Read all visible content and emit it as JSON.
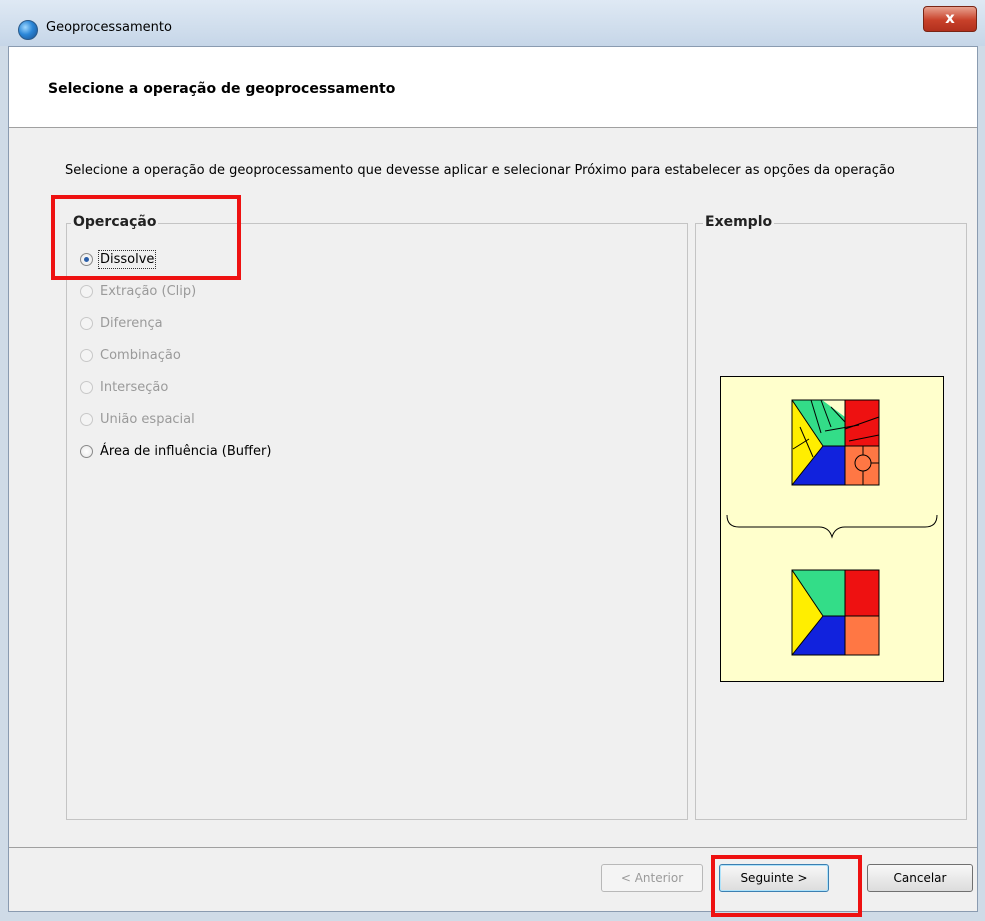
{
  "window": {
    "title": "Geoprocessamento",
    "close_label": "x"
  },
  "header": {
    "title": "Selecione a operação de geoprocessamento"
  },
  "instruction": "Selecione a operação de geoprocessamento que devesse aplicar e selecionar Próximo para estabelecer as opções da operação",
  "operation_group": {
    "legend": "Opercação",
    "options": [
      {
        "label": "Dissolve",
        "checked": true,
        "enabled": true
      },
      {
        "label": "Extração (Clip)",
        "checked": false,
        "enabled": false
      },
      {
        "label": "Diferença",
        "checked": false,
        "enabled": false
      },
      {
        "label": "Combinação",
        "checked": false,
        "enabled": false
      },
      {
        "label": "Interseção",
        "checked": false,
        "enabled": false
      },
      {
        "label": "União espacial",
        "checked": false,
        "enabled": false
      },
      {
        "label": "Área de influência (Buffer)",
        "checked": false,
        "enabled": true
      }
    ]
  },
  "example_group": {
    "legend": "Exemplo"
  },
  "buttons": {
    "prev": "< Anterior",
    "next": "Seguinte >",
    "cancel": "Cancelar"
  },
  "colors": {
    "green": "#33dd88",
    "red": "#ee1111",
    "yellow": "#ffee00",
    "blue": "#1122dd",
    "orange": "#ff7744",
    "highlight": "#ee1111"
  }
}
